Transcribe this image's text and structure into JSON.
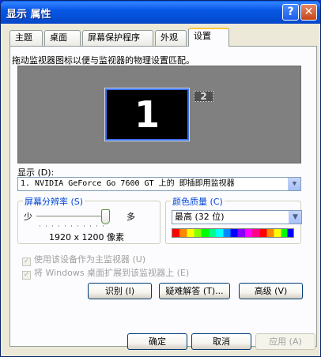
{
  "window": {
    "title": "显示 属性",
    "help_glyph": "?",
    "close_glyph": "✕"
  },
  "tabs": [
    {
      "label": "主题"
    },
    {
      "label": "桌面"
    },
    {
      "label": "屏幕保护程序"
    },
    {
      "label": "外观"
    },
    {
      "label": "设置",
      "active": true
    }
  ],
  "settings": {
    "description": "拖动监视器图标以便与监视器的物理设置匹配。",
    "monitors": [
      {
        "number": "1"
      },
      {
        "number": "2"
      }
    ],
    "display_label": "显示 (D):",
    "display_value": "1. NVIDIA GeForce Go 7600 GT 上的 即插即用监视器",
    "resolution": {
      "title": "屏幕分辨率 (S)",
      "less": "少",
      "more": "多",
      "value": "1920 x 1200 像素",
      "slider_position": 1.0
    },
    "color_quality": {
      "title": "颜色质量 (C)",
      "value": "最高 (32 位)"
    },
    "checkbox_primary": "使用该设备作为主监视器 (U)",
    "checkbox_extend": "将 Windows 桌面扩展到该监视器上 (E)",
    "buttons": {
      "identify": "识别 (I)",
      "troubleshoot": "疑难解答 (T)...",
      "advanced": "高级 (V)"
    }
  },
  "footer": {
    "ok": "确定",
    "cancel": "取消",
    "apply": "应用 (A)"
  },
  "colors": {
    "titlebar": "#0858e6",
    "group_title": "#0046d5",
    "active_tab_highlight": "#ffc83c"
  }
}
